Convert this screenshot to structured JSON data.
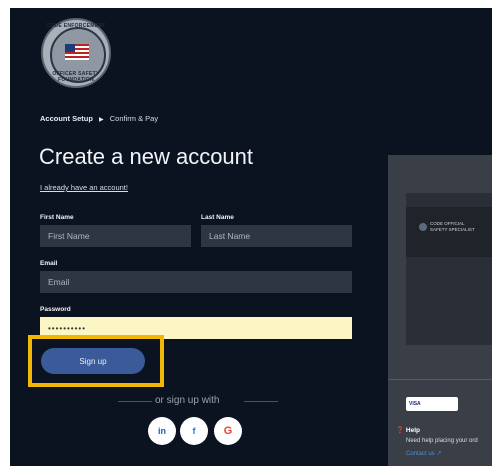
{
  "logo": {
    "top_text": "CODE ENFORCEMENT",
    "bottom_text": "OFFICER SAFETY FOUNDATION"
  },
  "breadcrumb": {
    "step1": "Account Setup",
    "separator": "▶",
    "step2": "Confirm & Pay"
  },
  "page_title": "Create a new account",
  "already_link": "I already have an account!",
  "form": {
    "first_name": {
      "label": "First Name",
      "placeholder": "First Name"
    },
    "last_name": {
      "label": "Last Name",
      "placeholder": "Last Name"
    },
    "email": {
      "label": "Email",
      "placeholder": "Email"
    },
    "password": {
      "label": "Password",
      "value": "••••••••••"
    }
  },
  "signup_button": "Sign up",
  "or_divider": "or sign up with",
  "social": {
    "linkedin": "in",
    "facebook": "f",
    "google": "G"
  },
  "right_panel": {
    "video_title_line1": "CODE OFFICIAL",
    "video_title_line2": "SAFETY SPECIALIST",
    "card_logos": "VISA",
    "help_title": "Help",
    "help_text": "Need help placing your ord",
    "help_link": "Contact us ↗"
  },
  "colors": {
    "background": "#0b1220",
    "input_bg": "#2e3644",
    "autofill_bg": "#fbf6c4",
    "button_bg": "#3b5a9a",
    "highlight": "#f2b705"
  }
}
